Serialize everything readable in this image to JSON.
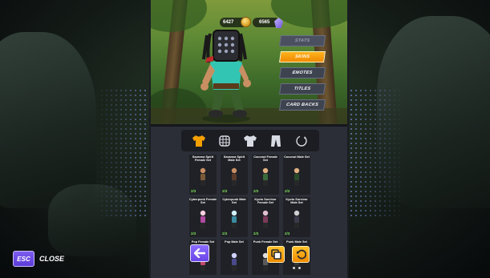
{
  "currency": {
    "gold": "6427",
    "gems": "6565"
  },
  "menu": {
    "items": [
      {
        "label": "STATS",
        "state": "disabled"
      },
      {
        "label": "SKINS",
        "state": "active"
      },
      {
        "label": "EMOTES",
        "state": "normal"
      },
      {
        "label": "TITLES",
        "state": "normal"
      },
      {
        "label": "CARD BACKS",
        "state": "normal"
      }
    ]
  },
  "categories": [
    {
      "icon": "shirt-icon",
      "selected": true
    },
    {
      "icon": "mask-icon",
      "selected": false
    },
    {
      "icon": "tshirt-icon",
      "selected": false
    },
    {
      "icon": "pants-icon",
      "selected": false
    },
    {
      "icon": "shuffle-icon",
      "selected": false
    }
  ],
  "skins": [
    {
      "name": "Savanna Spirit Female Set",
      "count": "2/3"
    },
    {
      "name": "Savanna Spirit Male Set",
      "count": "2/3"
    },
    {
      "name": "Coconut Female Set",
      "count": "2/3"
    },
    {
      "name": "Coconut Male Set",
      "count": "2/3"
    },
    {
      "name": "Cyberpunk Female Set",
      "count": "2/3"
    },
    {
      "name": "Cyberpunk Male Set",
      "count": "2/3"
    },
    {
      "name": "Kyoto Survivor Female Set",
      "count": "2/3"
    },
    {
      "name": "Kyoto Survivor Male Set",
      "count": "2/3"
    },
    {
      "name": "Pop Female Set",
      "count": ""
    },
    {
      "name": "Pop Male Set",
      "count": ""
    },
    {
      "name": "Punk Female Set",
      "count": ""
    },
    {
      "name": "Punk Male Set",
      "count": ""
    }
  ],
  "close": {
    "key": "ESC",
    "label": "CLOSE"
  },
  "colors": {
    "accent_orange": "#f5a000",
    "accent_purple": "#7255ee",
    "owned_green": "#7fe35a"
  }
}
